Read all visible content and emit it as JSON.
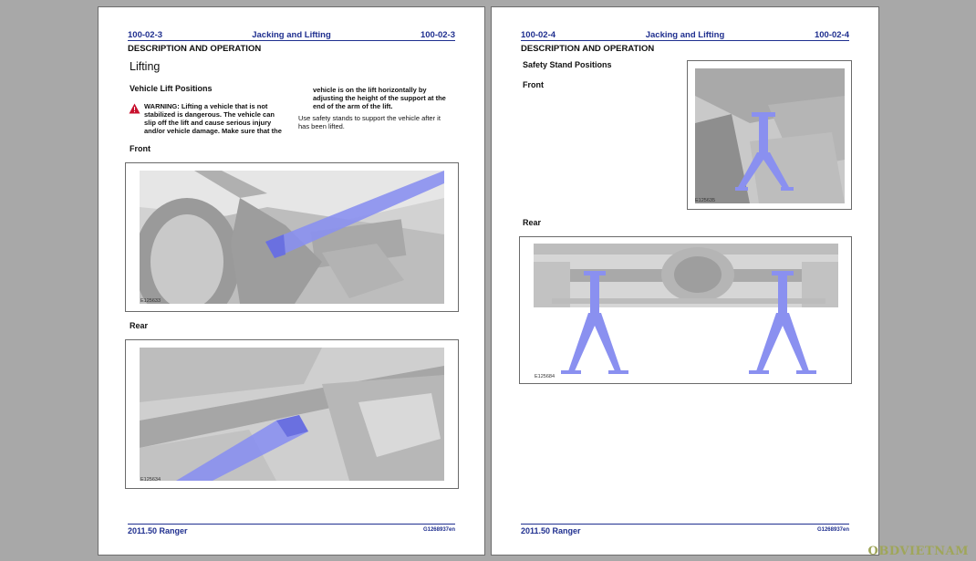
{
  "left_page": {
    "page_number_left": "100-02-3",
    "chapter_title": "Jacking and Lifting",
    "page_number_right": "100-02-3",
    "section_title": "DESCRIPTION AND OPERATION",
    "heading": "Lifting",
    "subheading": "Vehicle Lift Positions",
    "warning_line1": "WARNING: Lifting a vehicle that is not",
    "warning_line2": "stabilized is dangerous. The vehicle can",
    "warning_line3": "slip off the lift and cause serious injury",
    "warning_line4": "and/or vehicle damage. Make sure that the",
    "warning_cont1": "vehicle is on the lift horizontally by",
    "warning_cont2": "adjusting the height of the support at the",
    "warning_cont3": "end of the arm of the lift.",
    "note_line1": "Use safety stands to support the vehicle after it",
    "note_line2": "has been lifted.",
    "front_label": "Front",
    "front_figure_id": "E125633",
    "rear_label": "Rear",
    "rear_figure_id": "E125634",
    "footer_model": "2011.50 Ranger",
    "footer_code": "G1268937en"
  },
  "right_page": {
    "page_number_left": "100-02-4",
    "chapter_title": "Jacking and Lifting",
    "page_number_right": "100-02-4",
    "section_title": "DESCRIPTION AND OPERATION",
    "subheading": "Safety Stand Positions",
    "front_label": "Front",
    "front_figure_id": "E125635",
    "rear_label": "Rear",
    "rear_figure_id": "E125684",
    "footer_model": "2011.50 Ranger",
    "footer_code": "G1268937en"
  },
  "watermark": "OBDVIETNAM",
  "colors": {
    "header_blue": "#1f2f8f",
    "highlight_blue": "#7f86e8",
    "warning_red": "#c8102e",
    "background": "#a8a8a8"
  },
  "icons": {
    "warning": "warning-triangle-icon"
  }
}
